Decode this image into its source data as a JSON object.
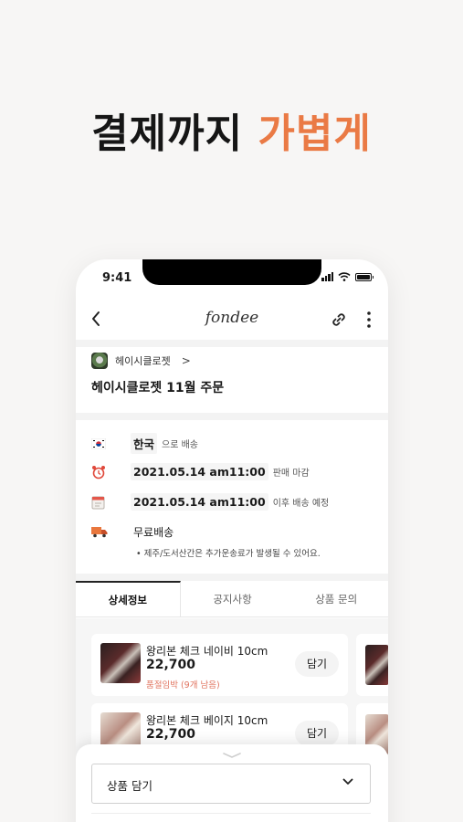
{
  "headline": {
    "part1": "결제까지",
    "part2": "가볍게"
  },
  "colors": {
    "accent": "#ea7a45",
    "stock_text": "#e0735e"
  },
  "status_bar": {
    "time": "9:41",
    "icons": [
      "signal-icon",
      "wifi-icon",
      "battery-icon"
    ]
  },
  "nav": {
    "brand": "fondee",
    "icons": [
      "back-icon",
      "link-icon",
      "more-icon"
    ]
  },
  "store": {
    "name": "헤이시클로젯",
    "chevron": ">"
  },
  "product_title": "헤이시클로젯 11월 주문",
  "info": {
    "country": {
      "value": "한국",
      "suffix": "으로 배송",
      "icon": "korea-flag-icon"
    },
    "deadline": {
      "value": "2021.05.14 am11:00",
      "suffix": "판매 마감",
      "icon": "alarm-clock-icon"
    },
    "ship_date": {
      "value": "2021.05.14 am11:00",
      "suffix": "이후 배송 예정",
      "icon": "calendar-icon"
    },
    "shipping": {
      "value": "무료배송",
      "note": "• 제주/도서산간은 추가운송료가 발생될 수 있어요.",
      "icon": "truck-icon"
    }
  },
  "tabs": [
    {
      "label": "상세정보",
      "active": true
    },
    {
      "label": "공지사항",
      "active": false
    },
    {
      "label": "상품 문의",
      "active": false
    }
  ],
  "products": [
    {
      "name": "왕리본 체크 네이비 10cm",
      "price": "22,700",
      "stock": "품절임박 (9개 남음)",
      "add": "담기"
    },
    {
      "name": "왕리본 체크 베이지 10cm",
      "price": "22,700",
      "add": "담기"
    }
  ],
  "sheet": {
    "select_label": "상품 담기"
  }
}
